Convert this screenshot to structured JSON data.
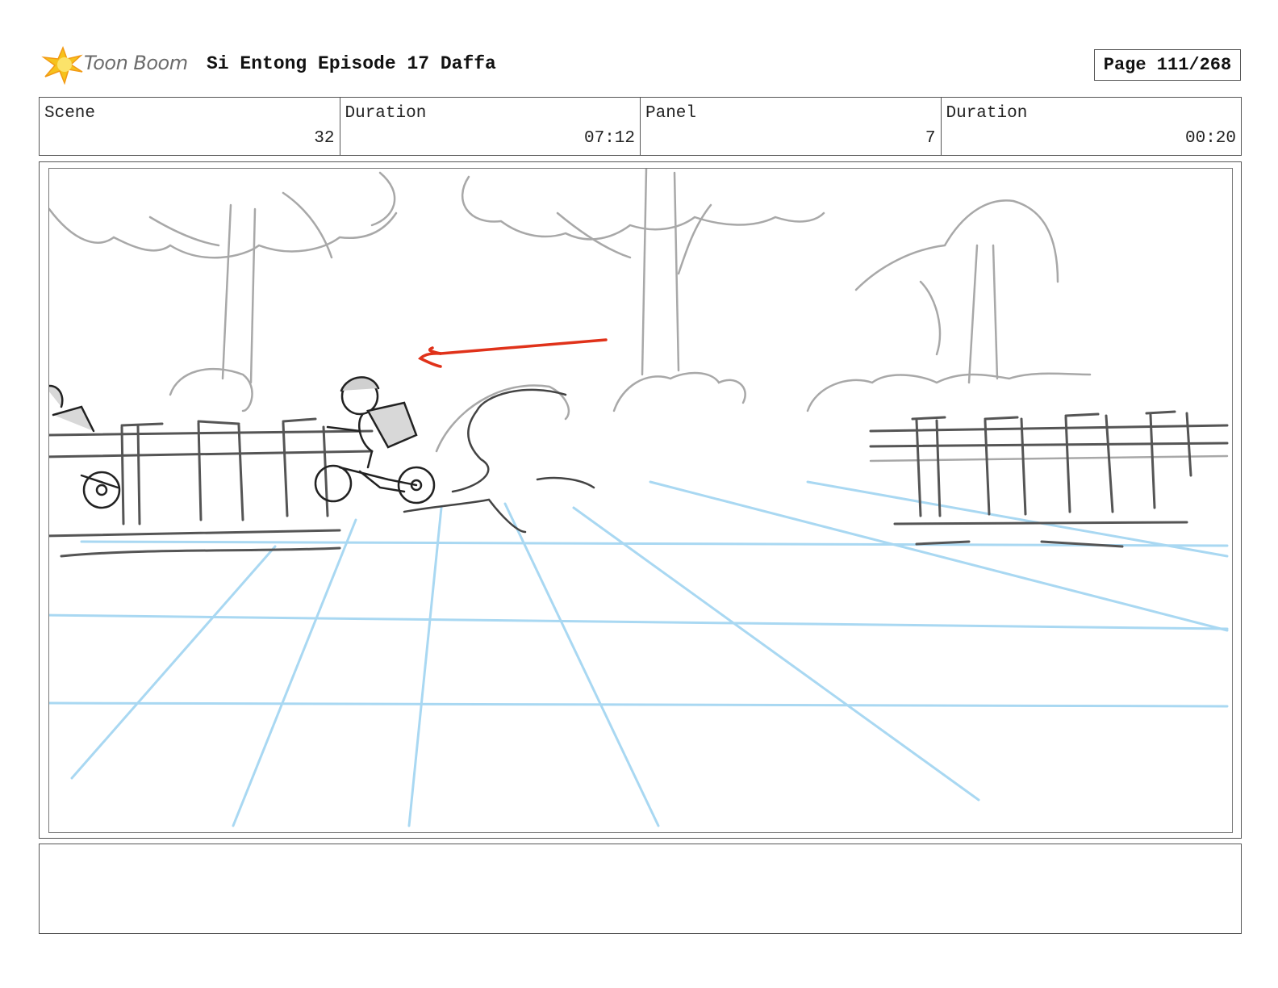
{
  "header": {
    "logo_text": "Toon Boom",
    "project_title": "Si Entong Episode 17 Daffa",
    "page_label": "Page 111/268"
  },
  "info": {
    "scene_label": "Scene",
    "scene_value": "32",
    "scene_duration_label": "Duration",
    "scene_duration_value": "07:12",
    "panel_label": "Panel",
    "panel_value": "7",
    "panel_duration_label": "Duration",
    "panel_duration_value": "00:20"
  },
  "panel": {
    "direction_arrow_color": "#e0321a",
    "sketch_color": "#555555",
    "background_color": "#a8a8a8",
    "perspective_grid_color": "#a9d8f2"
  },
  "dialogue": {
    "text": ""
  }
}
